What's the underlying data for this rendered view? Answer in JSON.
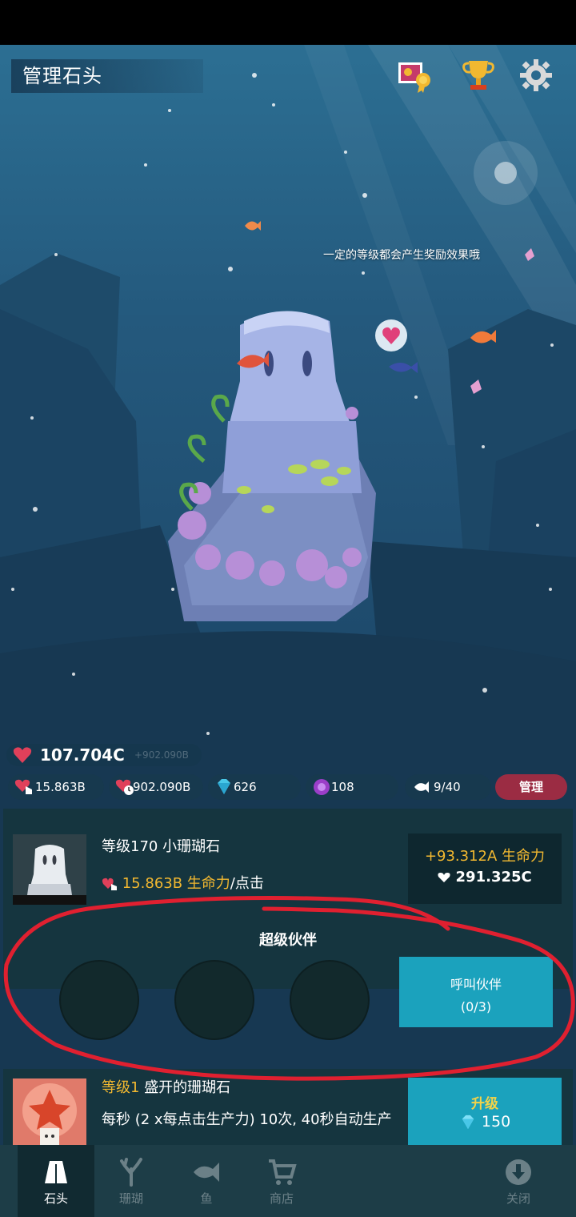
{
  "header": {
    "title": "管理石头",
    "icons": [
      "photo-award-icon",
      "trophy-icon",
      "gear-icon"
    ]
  },
  "scene": {
    "speech_text": "一定的等级都会产生奖励效果哦"
  },
  "resources": {
    "life": "107.704C",
    "life_sub": "+902.090B",
    "tap_value": "15.863B",
    "heart_value": "902.090B",
    "gems": "626",
    "pearls": "108",
    "fish": "9/40",
    "manage_label": "管理"
  },
  "stone_card": {
    "level_title": "等级170 小珊瑚石",
    "tap_income": "15.863B 生命力",
    "tap_suffix": "/点击",
    "income_plus": "+93.312A 生命力",
    "income_total": "291.325C",
    "partner_title": "超级伙伴",
    "call_label": "呼叫伙伴",
    "call_count": "(0/3)"
  },
  "coral_card": {
    "level": "等级1",
    "name": "盛开的珊瑚石",
    "desc": "每秒 (2 x每点击生产力) 10次, 40秒自动生产",
    "upgrade_label": "升级",
    "upgrade_cost": "150"
  },
  "tabs": [
    {
      "label": "石头",
      "icon": "stone-icon"
    },
    {
      "label": "珊瑚",
      "icon": "coral-icon"
    },
    {
      "label": "鱼",
      "icon": "fish-icon"
    },
    {
      "label": "商店",
      "icon": "cart-icon"
    },
    {
      "label": "关闭",
      "icon": "down-arrow-icon"
    }
  ],
  "colors": {
    "accent_gold": "#f2b830",
    "button_teal": "#1ba2bd",
    "manage_red": "#9b2c43",
    "annotation_red": "#e02030"
  }
}
